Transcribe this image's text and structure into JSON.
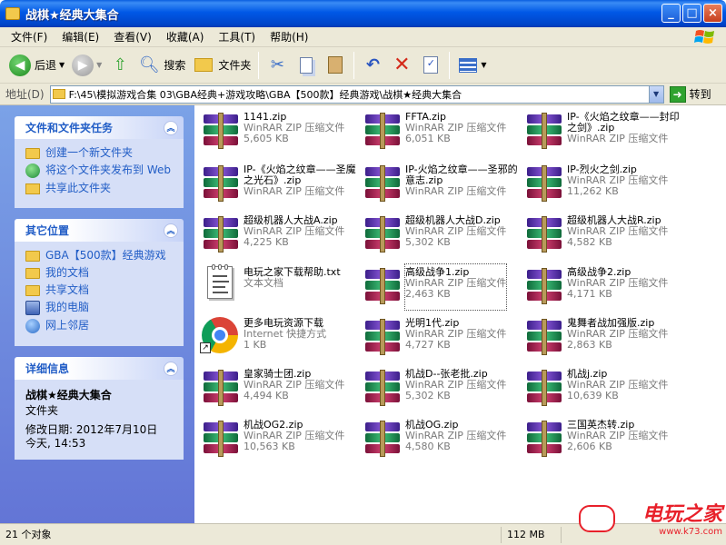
{
  "window": {
    "title": "战棋★经典大集合",
    "controls": [
      "_",
      "□",
      "×"
    ]
  },
  "menu": [
    "文件(F)",
    "编辑(E)",
    "查看(V)",
    "收藏(A)",
    "工具(T)",
    "帮助(H)"
  ],
  "toolbar": {
    "back": "后退",
    "search": "搜索",
    "folders": "文件夹"
  },
  "address": {
    "label": "地址(D)",
    "path": "F:\\45\\模拟游戏合集 03\\GBA经典+游戏攻略\\GBA【500款】经典游戏\\战棋★经典大集合",
    "go": "转到"
  },
  "tasks": {
    "file_tasks": {
      "title": "文件和文件夹任务",
      "items": [
        "创建一个新文件夹",
        "将这个文件夹发布到 Web",
        "共享此文件夹"
      ]
    },
    "other_places": {
      "title": "其它位置",
      "items": [
        "GBA【500款】经典游戏",
        "我的文档",
        "共享文档",
        "我的电脑",
        "网上邻居"
      ]
    },
    "details": {
      "title": "详细信息",
      "name": "战棋★经典大集合",
      "type": "文件夹",
      "modified": "修改日期: 2012年7月10日",
      "time": "今天, 14:53"
    }
  },
  "files": [
    {
      "icon": "rar",
      "name": "1141.zip",
      "type": "WinRAR ZIP 压缩文件",
      "size": "5,605 KB"
    },
    {
      "icon": "rar",
      "name": "FFTA.zip",
      "type": "WinRAR ZIP 压缩文件",
      "size": "6,051 KB"
    },
    {
      "icon": "rar",
      "name": "IP-《火焰之纹章——封印之剑》.zip",
      "type": "WinRAR ZIP 压缩文件",
      "size": ""
    },
    {
      "icon": "rar",
      "name": "IP-《火焰之纹章——圣魔之光石》.zip",
      "type": "WinRAR ZIP 压缩文件",
      "size": ""
    },
    {
      "icon": "rar",
      "name": "IP-火焰之纹章——圣邪的意志.zip",
      "type": "WinRAR ZIP 压缩文件",
      "size": ""
    },
    {
      "icon": "rar",
      "name": "IP-烈火之剑.zip",
      "type": "WinRAR ZIP 压缩文件",
      "size": "11,262 KB"
    },
    {
      "icon": "rar",
      "name": "超级机器人大战A.zip",
      "type": "WinRAR ZIP 压缩文件",
      "size": "4,225 KB"
    },
    {
      "icon": "rar",
      "name": "超级机器人大战D.zip",
      "type": "WinRAR ZIP 压缩文件",
      "size": "5,302 KB"
    },
    {
      "icon": "rar",
      "name": "超级机器人大战R.zip",
      "type": "WinRAR ZIP 压缩文件",
      "size": "4,582 KB"
    },
    {
      "icon": "txt",
      "name": "电玩之家下载帮助.txt",
      "type": "文本文档",
      "size": ""
    },
    {
      "icon": "rar",
      "name": "高级战争1.zip",
      "type": "WinRAR ZIP 压缩文件",
      "size": "2,463 KB",
      "selected": true
    },
    {
      "icon": "rar",
      "name": "高级战争2.zip",
      "type": "WinRAR ZIP 压缩文件",
      "size": "4,171 KB"
    },
    {
      "icon": "chrome",
      "name": "更多电玩资源下载",
      "type": "Internet 快捷方式",
      "size": "1 KB"
    },
    {
      "icon": "rar",
      "name": "光明1代.zip",
      "type": "WinRAR ZIP 压缩文件",
      "size": "4,727 KB"
    },
    {
      "icon": "rar",
      "name": "鬼舞者战加强版.zip",
      "type": "WinRAR ZIP 压缩文件",
      "size": "2,863 KB"
    },
    {
      "icon": "rar",
      "name": "皇家骑士团.zip",
      "type": "WinRAR ZIP 压缩文件",
      "size": "4,494 KB"
    },
    {
      "icon": "rar",
      "name": "机战D--张老批.zip",
      "type": "WinRAR ZIP 压缩文件",
      "size": "5,302 KB"
    },
    {
      "icon": "rar",
      "name": "机战j.zip",
      "type": "WinRAR ZIP 压缩文件",
      "size": "10,639 KB"
    },
    {
      "icon": "rar",
      "name": "机战OG2.zip",
      "type": "WinRAR ZIP 压缩文件",
      "size": "10,563 KB"
    },
    {
      "icon": "rar",
      "name": "机战OG.zip",
      "type": "WinRAR ZIP 压缩文件",
      "size": "4,580 KB"
    },
    {
      "icon": "rar",
      "name": "三国英杰转.zip",
      "type": "WinRAR ZIP 压缩文件",
      "size": "2,606 KB"
    }
  ],
  "status": {
    "count": "21 个对象",
    "size": "112 MB"
  },
  "watermark": {
    "brand": "电玩之家",
    "url": "www.k73.com"
  }
}
